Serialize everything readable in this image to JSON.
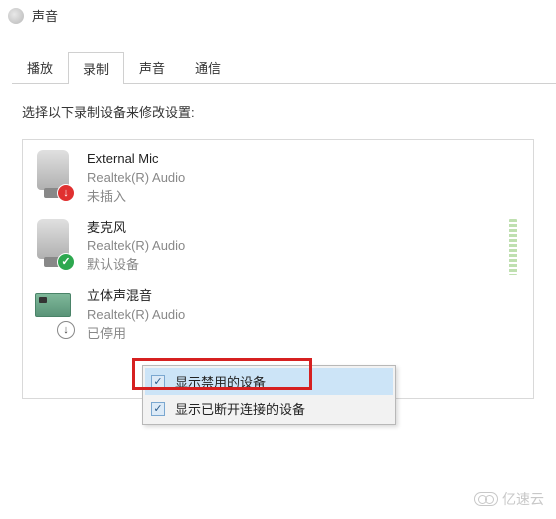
{
  "window": {
    "title": "声音"
  },
  "tabs": [
    {
      "label": "播放",
      "active": false
    },
    {
      "label": "录制",
      "active": true
    },
    {
      "label": "声音",
      "active": false
    },
    {
      "label": "通信",
      "active": false
    }
  ],
  "instruction": "选择以下录制设备来修改设置:",
  "devices": [
    {
      "name": "External Mic",
      "driver": "Realtek(R) Audio",
      "status": "未插入",
      "badge": "error",
      "icon": "mic"
    },
    {
      "name": "麦克风",
      "driver": "Realtek(R) Audio",
      "status": "默认设备",
      "badge": "ok",
      "icon": "mic",
      "level": true
    },
    {
      "name": "立体声混音",
      "driver": "Realtek(R) Audio",
      "status": "已停用",
      "badge": "down",
      "icon": "card"
    }
  ],
  "context_menu": {
    "items": [
      {
        "label": "显示禁用的设备",
        "checked": true,
        "highlighted": true
      },
      {
        "label": "显示已断开连接的设备",
        "checked": true,
        "highlighted": false
      }
    ]
  },
  "watermark": "亿速云"
}
